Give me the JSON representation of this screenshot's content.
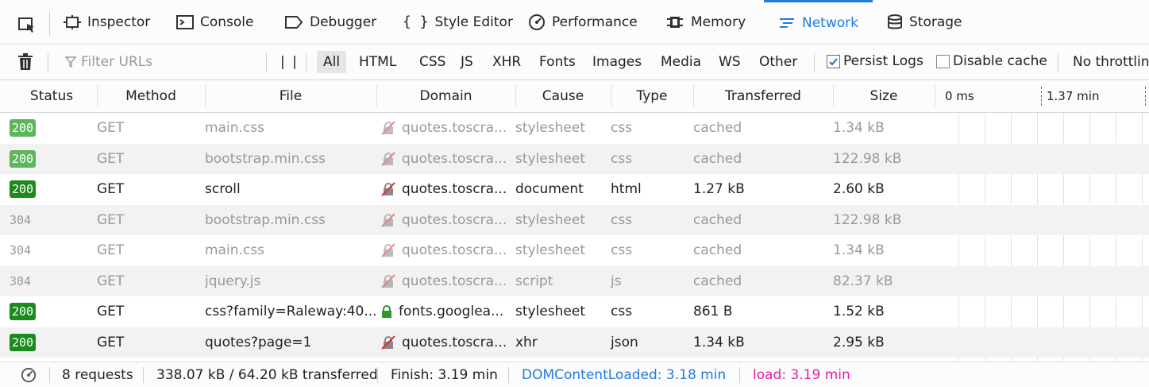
{
  "tabs": [
    {
      "label": "Inspector",
      "icon": "inspector-icon"
    },
    {
      "label": "Console",
      "icon": "console-icon"
    },
    {
      "label": "Debugger",
      "icon": "debugger-icon"
    },
    {
      "label": "Style Editor",
      "icon": "style-editor-icon"
    },
    {
      "label": "Performance",
      "icon": "performance-icon"
    },
    {
      "label": "Memory",
      "icon": "memory-icon"
    },
    {
      "label": "Network",
      "icon": "network-icon",
      "active": true
    },
    {
      "label": "Storage",
      "icon": "storage-icon"
    }
  ],
  "toolbar": {
    "filter_placeholder": "Filter URLs",
    "pause_label": "| |",
    "types": [
      "All",
      "HTML",
      "CSS",
      "JS",
      "XHR",
      "Fonts",
      "Images",
      "Media",
      "WS",
      "Other"
    ],
    "selected_type": "All",
    "persist_logs": "Persist Logs",
    "persist_checked": true,
    "disable_cache": "Disable cache",
    "disable_checked": false,
    "throttling": "No throttlin"
  },
  "columns": [
    "Status",
    "Method",
    "File",
    "Domain",
    "Cause",
    "Type",
    "Transferred",
    "Size",
    "0 ms",
    "1.37 min"
  ],
  "rows": [
    {
      "status": "200",
      "method": "GET",
      "file": "main.css",
      "domain": "quotes.toscra...",
      "cause": "stylesheet",
      "type": "css",
      "transferred": "cached",
      "size": "1.34 kB",
      "dim": true,
      "secure": false
    },
    {
      "status": "200",
      "method": "GET",
      "file": "bootstrap.min.css",
      "domain": "quotes.toscra...",
      "cause": "stylesheet",
      "type": "css",
      "transferred": "cached",
      "size": "122.98 kB",
      "dim": true,
      "secure": false
    },
    {
      "status": "200",
      "method": "GET",
      "file": "scroll",
      "domain": "quotes.toscra...",
      "cause": "document",
      "type": "html",
      "transferred": "1.27 kB",
      "size": "2.60 kB",
      "dim": false,
      "secure": false
    },
    {
      "status": "304",
      "method": "GET",
      "file": "bootstrap.min.css",
      "domain": "quotes.toscra...",
      "cause": "stylesheet",
      "type": "css",
      "transferred": "cached",
      "size": "122.98 kB",
      "dim": true,
      "secure": false
    },
    {
      "status": "304",
      "method": "GET",
      "file": "main.css",
      "domain": "quotes.toscra...",
      "cause": "stylesheet",
      "type": "css",
      "transferred": "cached",
      "size": "1.34 kB",
      "dim": true,
      "secure": false
    },
    {
      "status": "304",
      "method": "GET",
      "file": "jquery.js",
      "domain": "quotes.toscra...",
      "cause": "script",
      "type": "js",
      "transferred": "cached",
      "size": "82.37 kB",
      "dim": true,
      "secure": false
    },
    {
      "status": "200",
      "method": "GET",
      "file": "css?family=Raleway:40...",
      "domain": "fonts.googlea...",
      "cause": "stylesheet",
      "type": "css",
      "transferred": "861 B",
      "size": "1.52 kB",
      "dim": false,
      "secure": true
    },
    {
      "status": "200",
      "method": "GET",
      "file": "quotes?page=1",
      "domain": "quotes.toscra...",
      "cause": "xhr",
      "type": "json",
      "transferred": "1.34 kB",
      "size": "2.95 kB",
      "dim": false,
      "secure": false
    }
  ],
  "footer": {
    "requests": "8 requests",
    "transferred": "338.07 kB / 64.20 kB transferred",
    "finish": "Finish: 3.19 min",
    "domcontentloaded": "DOMContentLoaded: 3.18 min",
    "load": "load: 3.19 min"
  },
  "colors": {
    "accent": "#1f7be0",
    "ok_badge": "#1d8a1d",
    "dcl": "#1f7be0",
    "load": "#e01fa6",
    "insecure": "#d33"
  }
}
